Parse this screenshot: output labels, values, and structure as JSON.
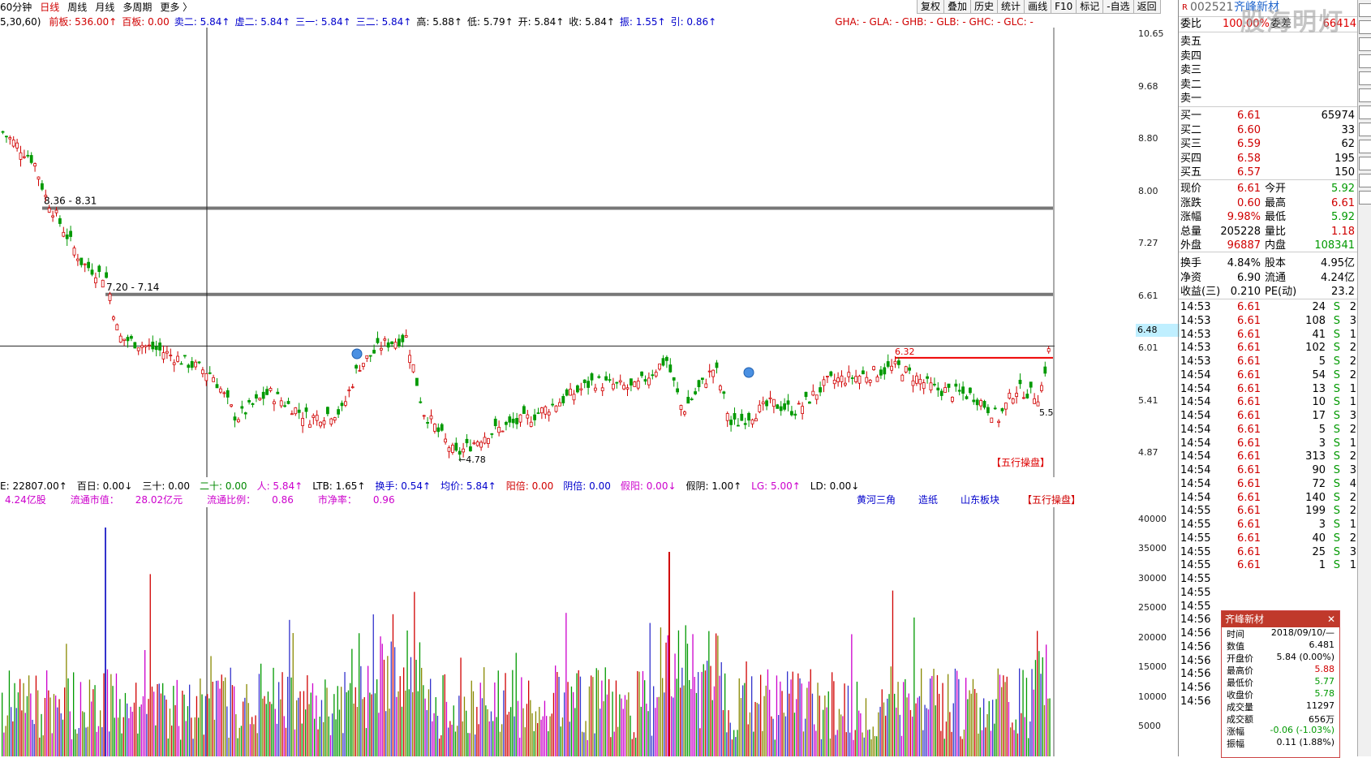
{
  "menu": {
    "items": [
      "60分钟",
      "日线",
      "周线",
      "月线",
      "多周期",
      "更多 〉"
    ],
    "active": "日线"
  },
  "toolbar": [
    "复权",
    "叠加",
    "历史",
    "统计",
    "画线",
    "F10",
    "标记",
    "-自选",
    "返回"
  ],
  "infobar": {
    "params": "5,30,60)",
    "items": [
      {
        "text": "前板: 536.00↑",
        "color": "r"
      },
      {
        "text": "百板: 0.00",
        "color": "r"
      },
      {
        "text": "卖二: 5.84↑",
        "color": "b"
      },
      {
        "text": "虚二: 5.84↑",
        "color": "b"
      },
      {
        "text": "三一: 5.84↑",
        "color": "b"
      },
      {
        "text": "三二: 5.84↑",
        "color": "b"
      },
      {
        "text": "高: 5.88↑",
        "color": "k"
      },
      {
        "text": "低: 5.79↑",
        "color": "k"
      },
      {
        "text": "开: 5.84↑",
        "color": "k"
      },
      {
        "text": "收: 5.84↑",
        "color": "k"
      },
      {
        "text": "振: 1.55↑",
        "color": "b"
      },
      {
        "text": "引: 0.86↑",
        "color": "b"
      },
      {
        "text": "GHA: -  GLA: -  GHB: -  GLB: -  GHC: -  GLC: -",
        "color": "r"
      }
    ]
  },
  "price_axis": [
    "10.65",
    "9.68",
    "8.80",
    "8.00",
    "7.27",
    "6.61",
    "6.01",
    "5.41",
    "4.87"
  ],
  "levels": [
    {
      "label": "8.36 - 8.31"
    },
    {
      "label": "7.20 - 7.14"
    }
  ],
  "annotations": {
    "current_price": "6.48",
    "high_marker": "6.32",
    "low_marker": "←4.78",
    "right_low": "5.5",
    "wuxing": "【五行操盘】"
  },
  "vol_infobar": {
    "items": [
      {
        "text": "E: 22807.00↑",
        "color": "k"
      },
      {
        "text": "百日: 0.00↓",
        "color": "k"
      },
      {
        "text": "三十: 0.00",
        "color": "k"
      },
      {
        "text": "二十: 0.00",
        "color": "g"
      },
      {
        "text": "人: 5.84↑",
        "color": "m"
      },
      {
        "text": "LTB: 1.65↑",
        "color": "k"
      },
      {
        "text": "换手: 0.54↑",
        "color": "b"
      },
      {
        "text": "均价: 5.84↑",
        "color": "b"
      },
      {
        "text": "阳倍: 0.00",
        "color": "r"
      },
      {
        "text": "阴倍: 0.00",
        "color": "b"
      },
      {
        "text": "假阳: 0.00↓",
        "color": "m"
      },
      {
        "text": "假阴: 1.00↑",
        "color": "k"
      },
      {
        "text": "LG: 5.00↑",
        "color": "m"
      },
      {
        "text": "LD: 0.00↓",
        "color": "k"
      }
    ],
    "row2": [
      {
        "text": "4.24亿股",
        "color": "m"
      },
      {
        "text": "流通市值：",
        "color": "m"
      },
      {
        "text": "28.02亿元",
        "color": "m"
      },
      {
        "text": "流通比例：",
        "color": "m"
      },
      {
        "text": "0.86",
        "color": "m"
      },
      {
        "text": "市净率：",
        "color": "m"
      },
      {
        "text": "0.96",
        "color": "m"
      }
    ],
    "tags": [
      "黄河三角",
      "造纸",
      "山东板块",
      "【五行操盘】"
    ]
  },
  "vol_axis": [
    "40000",
    "35000",
    "30000",
    "25000",
    "20000",
    "15000",
    "10000",
    "5000"
  ],
  "quote": {
    "code": "002521",
    "name": "齐峰新材",
    "weibi_label": "委比",
    "weibi": "100.00%",
    "weicha_label": "委差",
    "weicha": "66414",
    "sells": [
      {
        "label": "卖五",
        "price": "",
        "vol": ""
      },
      {
        "label": "卖四",
        "price": "",
        "vol": ""
      },
      {
        "label": "卖三",
        "price": "",
        "vol": ""
      },
      {
        "label": "卖二",
        "price": "",
        "vol": ""
      },
      {
        "label": "卖一",
        "price": "",
        "vol": ""
      }
    ],
    "buys": [
      {
        "label": "买一",
        "price": "6.61",
        "vol": "65974"
      },
      {
        "label": "买二",
        "price": "6.60",
        "vol": "33"
      },
      {
        "label": "买三",
        "price": "6.59",
        "vol": "62"
      },
      {
        "label": "买四",
        "price": "6.58",
        "vol": "195"
      },
      {
        "label": "买五",
        "price": "6.57",
        "vol": "150"
      }
    ],
    "stats": [
      {
        "l1": "现价",
        "v1": "6.61",
        "c1": "r",
        "l2": "今开",
        "v2": "5.92",
        "c2": "g"
      },
      {
        "l1": "涨跌",
        "v1": "0.60",
        "c1": "r",
        "l2": "最高",
        "v2": "6.61",
        "c2": "r"
      },
      {
        "l1": "涨幅",
        "v1": "9.98%",
        "c1": "r",
        "l2": "最低",
        "v2": "5.92",
        "c2": "g"
      },
      {
        "l1": "总量",
        "v1": "205228",
        "c1": "k",
        "l2": "量比",
        "v2": "1.18",
        "c2": "r"
      },
      {
        "l1": "外盘",
        "v1": "96887",
        "c1": "r",
        "l2": "内盘",
        "v2": "108341",
        "c2": "g"
      },
      {
        "l1": "换手",
        "v1": "4.84%",
        "c1": "k",
        "l2": "股本",
        "v2": "4.95亿",
        "c2": "k"
      },
      {
        "l1": "净资",
        "v1": "6.90",
        "c1": "k",
        "l2": "流通",
        "v2": "4.24亿",
        "c2": "k"
      },
      {
        "l1": "收益(三)",
        "v1": "0.210",
        "c1": "k",
        "l2": "PE(动)",
        "v2": "23.2",
        "c2": "k"
      }
    ],
    "ticks": [
      {
        "t": "14:53",
        "p": "6.61",
        "v": "24",
        "s": "S",
        "n": "2"
      },
      {
        "t": "14:53",
        "p": "6.61",
        "v": "108",
        "s": "S",
        "n": "3"
      },
      {
        "t": "14:53",
        "p": "6.61",
        "v": "41",
        "s": "S",
        "n": "1"
      },
      {
        "t": "14:53",
        "p": "6.61",
        "v": "102",
        "s": "S",
        "n": "2"
      },
      {
        "t": "14:53",
        "p": "6.61",
        "v": "5",
        "s": "S",
        "n": "2"
      },
      {
        "t": "14:54",
        "p": "6.61",
        "v": "54",
        "s": "S",
        "n": "2"
      },
      {
        "t": "14:54",
        "p": "6.61",
        "v": "13",
        "s": "S",
        "n": "1"
      },
      {
        "t": "14:54",
        "p": "6.61",
        "v": "10",
        "s": "S",
        "n": "1"
      },
      {
        "t": "14:54",
        "p": "6.61",
        "v": "17",
        "s": "S",
        "n": "3"
      },
      {
        "t": "14:54",
        "p": "6.61",
        "v": "5",
        "s": "S",
        "n": "2"
      },
      {
        "t": "14:54",
        "p": "6.61",
        "v": "3",
        "s": "S",
        "n": "1"
      },
      {
        "t": "14:54",
        "p": "6.61",
        "v": "313",
        "s": "S",
        "n": "2"
      },
      {
        "t": "14:54",
        "p": "6.61",
        "v": "90",
        "s": "S",
        "n": "3"
      },
      {
        "t": "14:54",
        "p": "6.61",
        "v": "72",
        "s": "S",
        "n": "4"
      },
      {
        "t": "14:54",
        "p": "6.61",
        "v": "140",
        "s": "S",
        "n": "2"
      },
      {
        "t": "14:55",
        "p": "6.61",
        "v": "199",
        "s": "S",
        "n": "2"
      },
      {
        "t": "14:55",
        "p": "6.61",
        "v": "3",
        "s": "S",
        "n": "1"
      },
      {
        "t": "14:55",
        "p": "6.61",
        "v": "40",
        "s": "S",
        "n": "2"
      },
      {
        "t": "14:55",
        "p": "6.61",
        "v": "25",
        "s": "S",
        "n": "3"
      },
      {
        "t": "14:55",
        "p": "6.61",
        "v": "1",
        "s": "S",
        "n": "1"
      },
      {
        "t": "14:55",
        "p": "",
        "v": "",
        "s": "",
        "n": ""
      },
      {
        "t": "14:55",
        "p": "",
        "v": "",
        "s": "",
        "n": ""
      },
      {
        "t": "14:55",
        "p": "",
        "v": "",
        "s": "",
        "n": ""
      },
      {
        "t": "14:56",
        "p": "",
        "v": "",
        "s": "",
        "n": ""
      },
      {
        "t": "14:56",
        "p": "",
        "v": "",
        "s": "",
        "n": ""
      },
      {
        "t": "14:56",
        "p": "",
        "v": "",
        "s": "",
        "n": ""
      },
      {
        "t": "14:56",
        "p": "",
        "v": "",
        "s": "",
        "n": ""
      },
      {
        "t": "14:56",
        "p": "",
        "v": "",
        "s": "",
        "n": ""
      },
      {
        "t": "14:56",
        "p": "",
        "v": "",
        "s": "",
        "n": ""
      },
      {
        "t": "14:56",
        "p": "",
        "v": "",
        "s": "",
        "n": ""
      }
    ]
  },
  "tooltip": {
    "title": "齐峰新材",
    "rows": [
      {
        "l": "时间",
        "v": "2018/09/10/—",
        "c": "k"
      },
      {
        "l": "数值",
        "v": "6.481",
        "c": "k"
      },
      {
        "l": "开盘价",
        "v": "5.84 (0.00%)",
        "c": "k"
      },
      {
        "l": "最高价",
        "v": "5.88",
        "c": "r"
      },
      {
        "l": "最低价",
        "v": "5.77",
        "c": "g"
      },
      {
        "l": "收盘价",
        "v": "5.78",
        "c": "g"
      },
      {
        "l": "成交量",
        "v": "11297",
        "c": "k"
      },
      {
        "l": "成交额",
        "v": "656万",
        "c": "k"
      },
      {
        "l": "涨幅",
        "v": "-0.06 (-1.03%)",
        "c": "g"
      },
      {
        "l": "振幅",
        "v": "0.11 (1.88%)",
        "c": "k"
      }
    ]
  },
  "watermark": "股海明灯",
  "side_icons": [
    "share-icon",
    "chart-icon",
    "list-icon",
    "grid-icon",
    "bar-icon",
    "fi-icon",
    "fund-icon",
    "news-icon",
    "rs-icon",
    "s-icon",
    "move-icon",
    "f-icon"
  ],
  "chart_data": {
    "type": "candlestick",
    "period": "日线",
    "ylim": [
      4.7,
      10.8
    ],
    "vol_ylim": [
      0,
      42000
    ],
    "levels": [
      8.35,
      7.18
    ],
    "cursor_price": 6.48,
    "resistance": 6.32
  }
}
